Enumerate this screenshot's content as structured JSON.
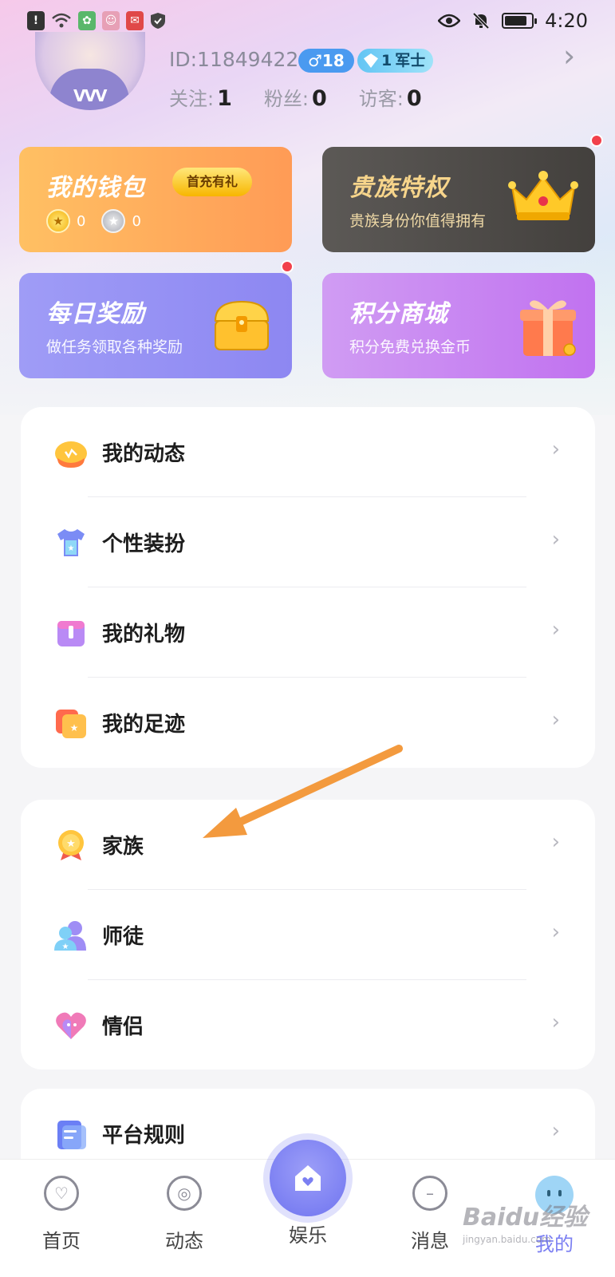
{
  "status_bar": {
    "time": "4:20",
    "battery_percent": 85
  },
  "profile": {
    "id_text": "ID:11849422",
    "age_badge": "♂18",
    "rank_level": "1",
    "rank_badge": "军士",
    "stats": [
      {
        "label": "关注:",
        "value": "1"
      },
      {
        "label": "粉丝:",
        "value": "0"
      },
      {
        "label": "访客:",
        "value": "0"
      }
    ]
  },
  "cards": {
    "wallet": {
      "title": "我的钱包",
      "tag": "首充有礼",
      "gold_count": "0",
      "silver_count": "0"
    },
    "noble": {
      "title": "贵族特权",
      "subtitle": "贵族身份你值得拥有"
    },
    "daily": {
      "title": "每日奖励",
      "subtitle": "做任务领取各种奖励"
    },
    "points": {
      "title": "积分商城",
      "subtitle": "积分免费兑换金币"
    }
  },
  "menu_groups": [
    {
      "items": [
        "我的动态",
        "个性装扮",
        "我的礼物",
        "我的足迹"
      ]
    },
    {
      "items": [
        "家族",
        "师徒",
        "情侣"
      ]
    },
    {
      "items": [
        "平台规则"
      ]
    }
  ],
  "tabs": {
    "home": "首页",
    "moments": "动态",
    "entertainment": "娱乐",
    "messages": "消息",
    "me": "我的"
  },
  "watermark": {
    "main": "Baidu经验",
    "sub": "jingyan.baidu.com"
  },
  "colors": {
    "accent": "#7b7ff2",
    "wallet": "#ff9b56",
    "noble_gold": "#f7d58b",
    "red_dot": "#f2414b",
    "annotation_arrow": "#f39a3e"
  }
}
